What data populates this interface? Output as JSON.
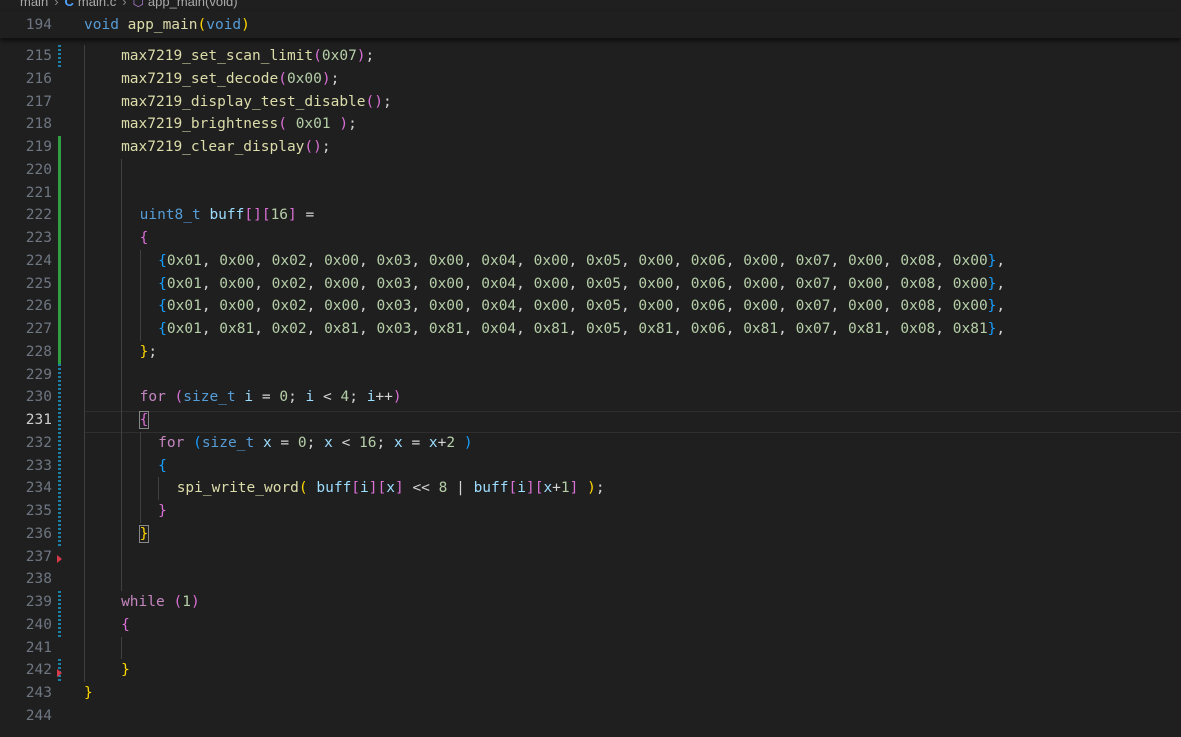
{
  "breadcrumb": {
    "folder": "main",
    "file": "main.c",
    "symbol": "app_main(void)",
    "file_icon": "c-file-icon",
    "symbol_icon": "function-icon"
  },
  "sticky": {
    "line_no": "194",
    "text": "void app_main(void)"
  },
  "active_line": "231",
  "lines": [
    {
      "n": "215",
      "text": "max7219_set_scan_limit(0x07);"
    },
    {
      "n": "216",
      "text": "max7219_set_decode(0x00);"
    },
    {
      "n": "217",
      "text": "max7219_display_test_disable();"
    },
    {
      "n": "218",
      "text": "max7219_brightness( 0x01 );"
    },
    {
      "n": "219",
      "text": "max7219_clear_display();"
    },
    {
      "n": "220",
      "text": ""
    },
    {
      "n": "221",
      "text": ""
    },
    {
      "n": "222",
      "text": "uint8_t buff[][16] ="
    },
    {
      "n": "223",
      "text": "{"
    },
    {
      "n": "224",
      "text": "{0x01, 0x00, 0x02, 0x00, 0x03, 0x00, 0x04, 0x00, 0x05, 0x00, 0x06, 0x00, 0x07, 0x00, 0x08, 0x00},"
    },
    {
      "n": "225",
      "text": "{0x01, 0x00, 0x02, 0x00, 0x03, 0x00, 0x04, 0x00, 0x05, 0x00, 0x06, 0x00, 0x07, 0x00, 0x08, 0x00},"
    },
    {
      "n": "226",
      "text": "{0x01, 0x00, 0x02, 0x00, 0x03, 0x00, 0x04, 0x00, 0x05, 0x00, 0x06, 0x00, 0x07, 0x00, 0x08, 0x00},"
    },
    {
      "n": "227",
      "text": "{0x01, 0x81, 0x02, 0x81, 0x03, 0x81, 0x04, 0x81, 0x05, 0x81, 0x06, 0x81, 0x07, 0x81, 0x08, 0x81},"
    },
    {
      "n": "228",
      "text": "};"
    },
    {
      "n": "229",
      "text": ""
    },
    {
      "n": "230",
      "text": "for (size_t i = 0; i < 4; i++)"
    },
    {
      "n": "231",
      "text": "{"
    },
    {
      "n": "232",
      "text": "for (size_t x = 0; x < 16; x = x+2 )"
    },
    {
      "n": "233",
      "text": "{"
    },
    {
      "n": "234",
      "text": "spi_write_word( buff[i][x] << 8 | buff[i][x+1] );"
    },
    {
      "n": "235",
      "text": "}"
    },
    {
      "n": "236",
      "text": "}"
    },
    {
      "n": "237",
      "text": ""
    },
    {
      "n": "238",
      "text": ""
    },
    {
      "n": "239",
      "text": "while (1)"
    },
    {
      "n": "240",
      "text": "{"
    },
    {
      "n": "241",
      "text": ""
    },
    {
      "n": "242",
      "text": "}"
    },
    {
      "n": "243",
      "text": "}"
    },
    {
      "n": "244",
      "text": ""
    }
  ],
  "colors": {
    "background": "#1f1f1f",
    "keyword": "#569cd6",
    "control": "#c586c0",
    "function": "#dcdcaa",
    "number": "#b5cea8",
    "variable": "#9cdcfe",
    "type": "#4ec9b0",
    "git_added": "#2ea043",
    "git_modified": "#1b81a8",
    "git_deleted": "#d73a49"
  }
}
